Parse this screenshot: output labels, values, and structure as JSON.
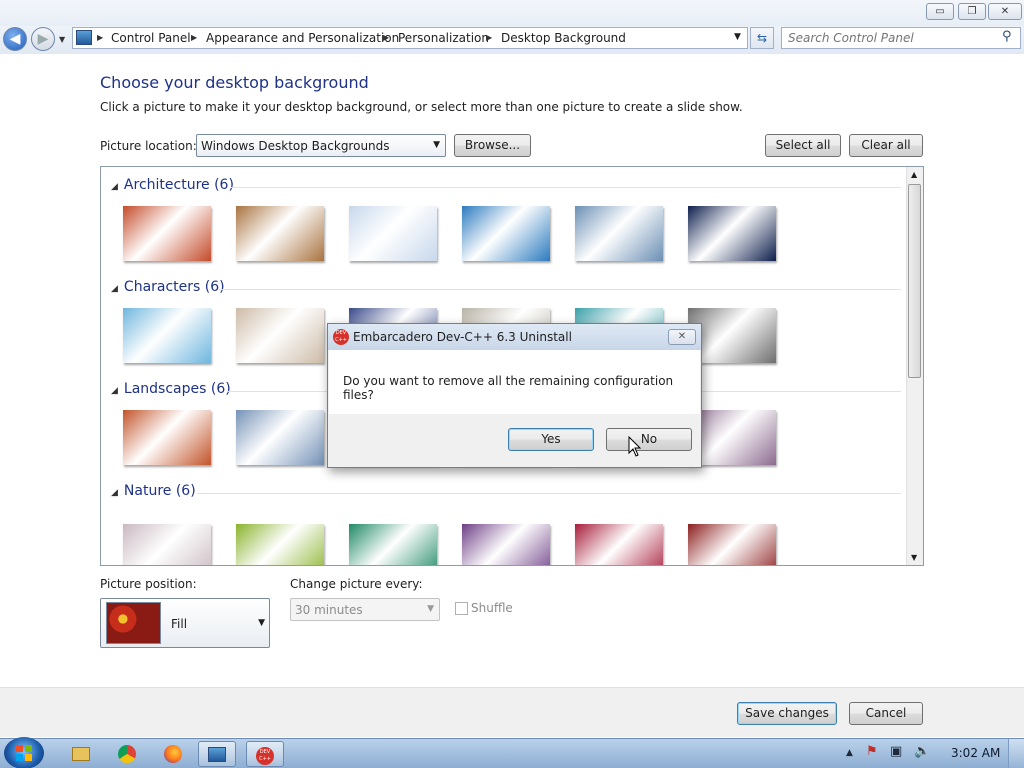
{
  "window": {
    "controls": {
      "minimize": "▭",
      "maximize": "❐",
      "close": "✕"
    }
  },
  "address_bar": {
    "crumbs": [
      "Control Panel",
      "Appearance and Personalization",
      "Personalization",
      "Desktop Background"
    ],
    "search_placeholder": "Search Control Panel"
  },
  "page": {
    "title": "Choose your desktop background",
    "subtitle": "Click a picture to make it your desktop background, or select more than one picture to create a slide show.",
    "picture_location_label": "Picture location:",
    "picture_location_value": "Windows Desktop Backgrounds",
    "browse_label": "Browse...",
    "select_all_label": "Select all",
    "clear_all_label": "Clear all"
  },
  "groups": [
    {
      "name": "Architecture (6)",
      "thumbs": [
        "#c44b2a",
        "#a9733f",
        "#c7d8ec",
        "#2b7bbf",
        "#6b8fb4",
        "#0e1f4d"
      ]
    },
    {
      "name": "Characters (6)",
      "thumbs": [
        "#6fb6df",
        "#cdbba7",
        "#3a4a8a",
        "#b9b3a6",
        "#3aa0a9",
        "#6e6e6e"
      ]
    },
    {
      "name": "Landscapes (6)",
      "thumbs": [
        "#c2542a",
        "#7592b7",
        "#8aa0b8",
        "#8aa0b8",
        "#8aa0b8",
        "#8c6a8f"
      ]
    },
    {
      "name": "Nature (6)",
      "thumbs": [
        "#c9b9c0",
        "#8ab32b",
        "#1e8a66",
        "#6e3f86",
        "#a61d3a",
        "#8c1f1f"
      ]
    }
  ],
  "dialog": {
    "title": "Embarcadero Dev-C++ 6.3 Uninstall",
    "message": "Do you want to remove all the remaining configuration files?",
    "yes_label": "Yes",
    "no_label": "No",
    "app_icon_text": "DEV C++"
  },
  "position": {
    "label": "Picture position:",
    "value": "Fill"
  },
  "interval": {
    "label": "Change picture every:",
    "value": "30 minutes",
    "shuffle_label": "Shuffle"
  },
  "footer": {
    "save_label": "Save changes",
    "cancel_label": "Cancel"
  },
  "taskbar": {
    "time": "3:02 AM",
    "devcpp_icon_text": "DEV C++"
  }
}
